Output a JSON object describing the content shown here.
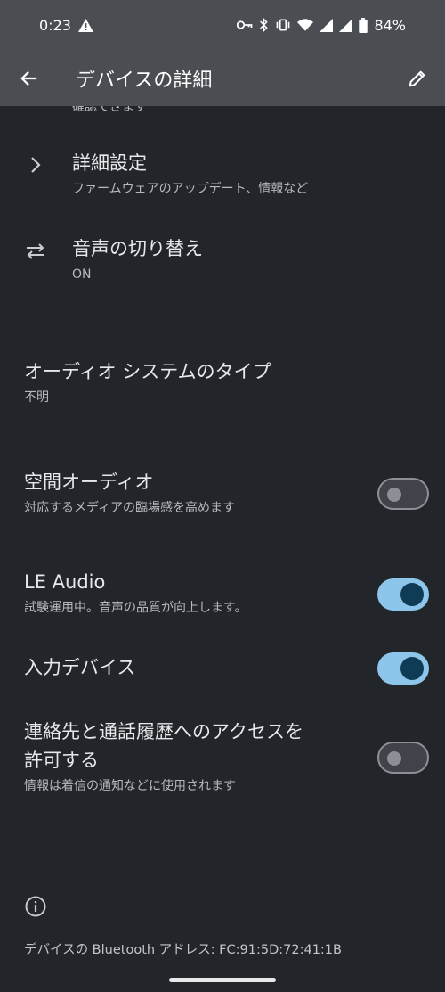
{
  "status_bar": {
    "time": "0:23",
    "battery": "84%"
  },
  "app_bar": {
    "title": "デバイスの詳細"
  },
  "clipped_text": "確認できます",
  "rows": {
    "advanced": {
      "title": "詳細設定",
      "subtitle": "ファームウェアのアップデート、情報など"
    },
    "audio_switch": {
      "title": "音声の切り替え",
      "subtitle": "ON"
    },
    "audio_system": {
      "title": "オーディオ システムのタイプ",
      "subtitle": "不明"
    },
    "spatial_audio": {
      "title": "空間オーディオ",
      "subtitle": "対応するメディアの臨場感を高めます",
      "enabled": false
    },
    "le_audio": {
      "title": "LE Audio",
      "subtitle": "試験運用中。音声の品質が向上します。",
      "enabled": true
    },
    "input_device": {
      "title": "入力デバイス",
      "enabled": true
    },
    "contacts_access": {
      "title_line1": "連絡先と通話履歴へのアクセスを",
      "title_line2": "許可する",
      "subtitle": "情報は着信の通知などに使用されます",
      "enabled": false
    }
  },
  "footer": {
    "bt_address": "デバイスの Bluetooth アドレス: FC:91:5D:72:41:1B"
  },
  "colors": {
    "background": "#222529",
    "app_bar": "#4a4e53",
    "toggle_on_track": "#8ec5ea",
    "toggle_on_knob": "#0f3b55",
    "toggle_off_outline": "#8c9096"
  }
}
